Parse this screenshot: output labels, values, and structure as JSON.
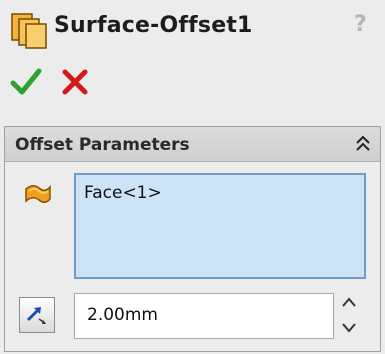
{
  "header": {
    "title": "Surface-Offset1",
    "feature_icon": "surface-offset-icon",
    "help_label": "?"
  },
  "actions": {
    "ok_icon": "checkmark-icon",
    "cancel_icon": "x-icon",
    "ok_color": "#2fa12f",
    "cancel_color": "#d21a1a"
  },
  "group": {
    "title": "Offset Parameters",
    "collapse_icon": "double-chevron-up-icon",
    "selection_icon": "face-icon",
    "selection_items": [
      "Face<1>"
    ],
    "reverse_icon": "reverse-direction-icon",
    "distance_value": "2.00mm",
    "spinner_up_icon": "chevron-up-icon",
    "spinner_down_icon": "chevron-down-icon"
  },
  "colors": {
    "selection_bg": "#cde4f8",
    "selection_border": "#6f9cc6",
    "accent_orange": "#f0a020"
  }
}
